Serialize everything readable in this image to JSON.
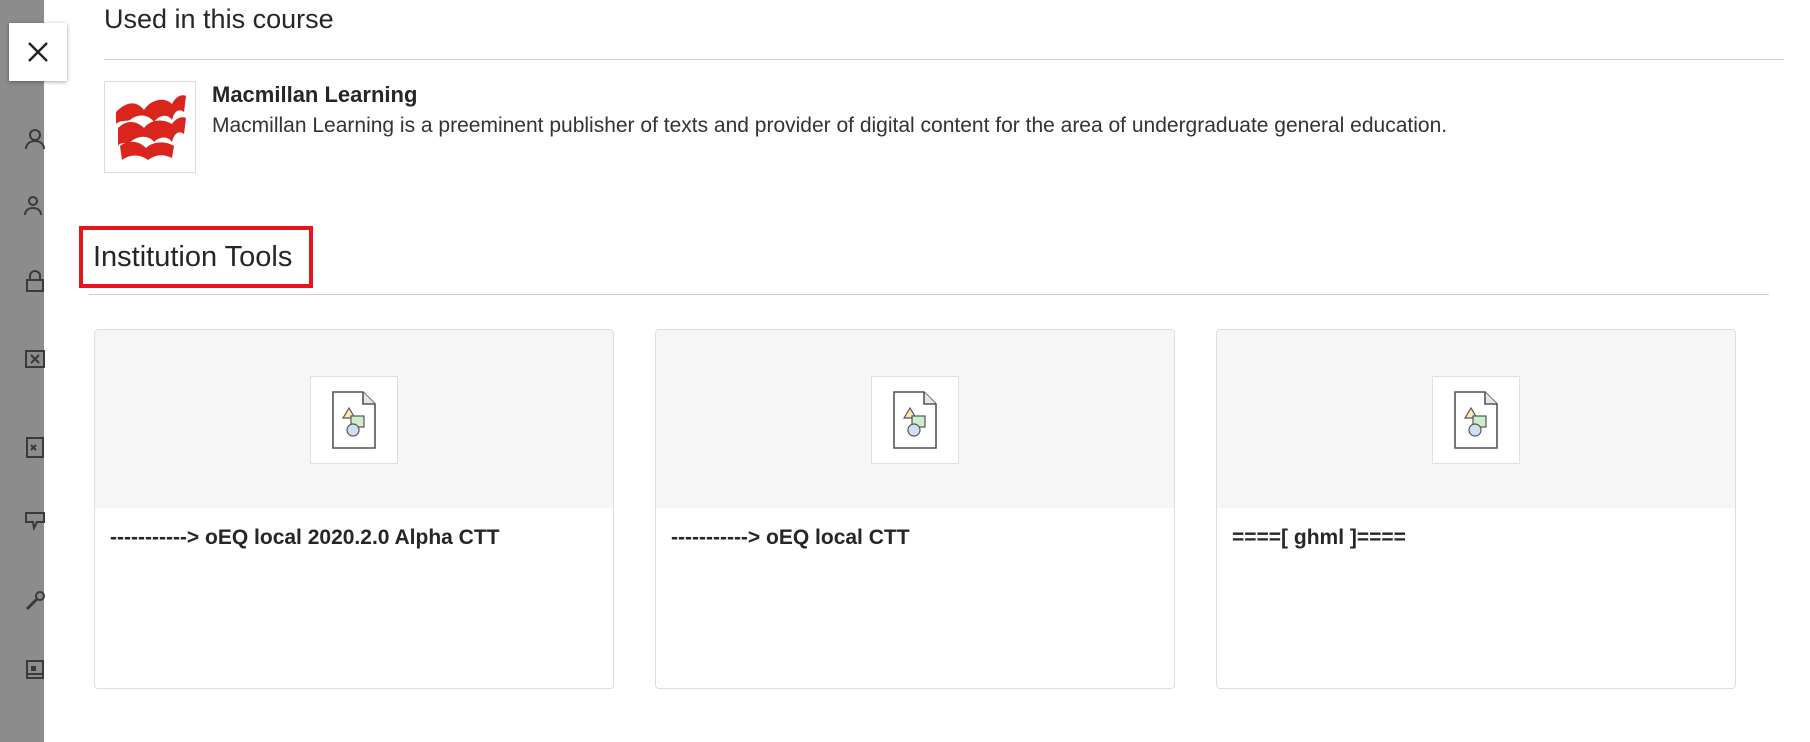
{
  "used_section": {
    "title": "Used in this course",
    "provider": {
      "name": "Macmillan Learning",
      "description": "Macmillan Learning is a preeminent publisher of texts and provider of digital content for the area of undergraduate general education."
    }
  },
  "institution_section": {
    "title": "Institution Tools",
    "tools": [
      {
        "label": "-----------> oEQ local 2020.2.0 Alpha CTT"
      },
      {
        "label": "-----------> oEQ local CTT"
      },
      {
        "label": "====[ ghml ]===="
      }
    ]
  },
  "colors": {
    "highlight_border": "#e8141b",
    "logo_red": "#d9251c",
    "rail": "#8c8c8c"
  },
  "icons": {
    "close": "close-icon",
    "tool_thumbnail": "generic-file-icon",
    "provider_logo": "macmillan-logo"
  }
}
